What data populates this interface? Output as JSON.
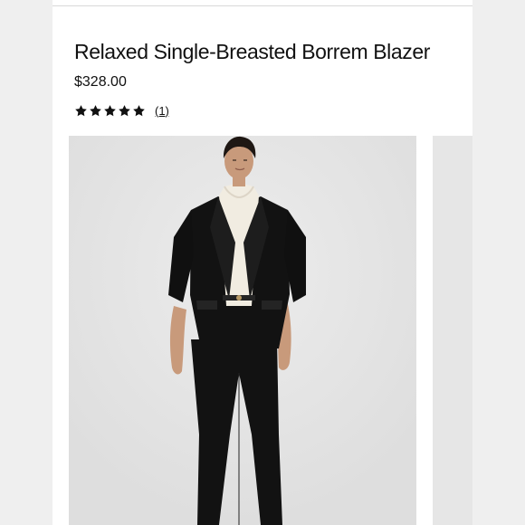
{
  "product": {
    "title": "Relaxed Single-Breasted Borrem Blazer",
    "price": "$328.00",
    "rating": {
      "stars": 5,
      "max_stars": 5,
      "review_count_label": "(1)"
    }
  },
  "gallery": {
    "main_image": "model wearing black blazer, cream turtleneck and black cropped trousers",
    "next_image": "partial next product image"
  },
  "colors": {
    "page_bg": "#efefef",
    "content_bg": "#ffffff",
    "text": "#111111",
    "photo_bg": "#e3e3e3",
    "garment": "#111111",
    "turtleneck": "#f1ece1"
  },
  "icons": {
    "star": "star-icon"
  }
}
